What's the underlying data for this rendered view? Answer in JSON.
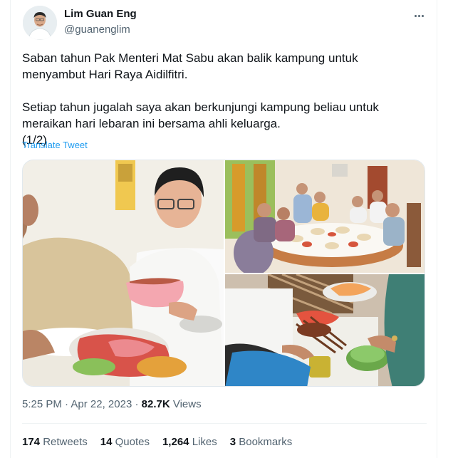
{
  "author": {
    "name": "Lim Guan Eng",
    "handle": "@guanenglim"
  },
  "tweet": {
    "text": "Saban tahun Pak Menteri Mat Sabu akan balik kampung untuk\nmenyambut Hari Raya Aidilfitri.\n\nSetiap tahun jugalah saya akan berkunjungi kampung beliau untuk\nmeraikan hari lebaran ini bersama ahli keluarga.\n(1/2)",
    "translate_label": "Translate Tweet",
    "time": "5:25 PM",
    "date": "Apr 22, 2023",
    "views_count": "82.7K",
    "views_label": "Views"
  },
  "stats": {
    "retweets_count": "174",
    "retweets_label": "Retweets",
    "quotes_count": "14",
    "quotes_label": "Quotes",
    "likes_count": "1,264",
    "likes_label": "Likes",
    "bookmarks_count": "3",
    "bookmarks_label": "Bookmarks"
  },
  "icons": {
    "more": "more-options-icon"
  },
  "colors": {
    "link": "#1d9bf0",
    "secondary_text": "#536471",
    "primary_text": "#0f1419"
  }
}
